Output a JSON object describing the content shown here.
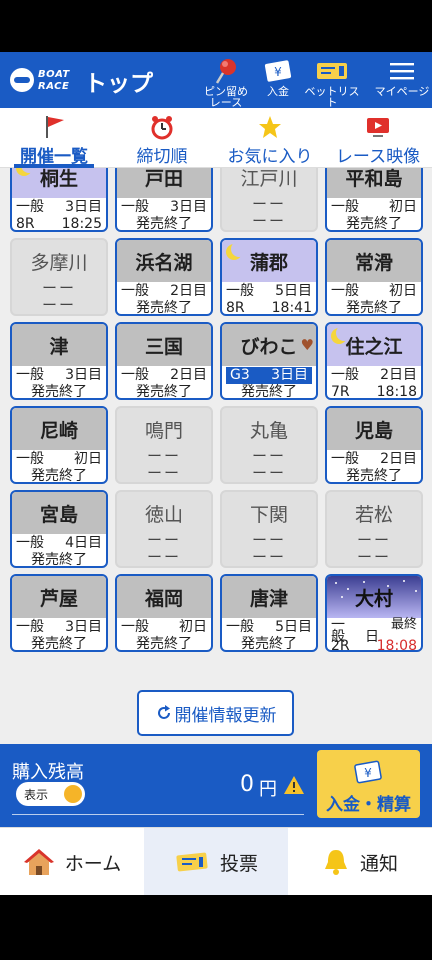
{
  "header": {
    "logo_line1": "BOAT",
    "logo_line2": "RACE",
    "title": "トップ",
    "pin_label_1": "ピン留め",
    "pin_label_2": "レース",
    "deposit_label": "入金",
    "betlist_label": "ベットリスト",
    "mypage_label": "マイページ"
  },
  "tabs": [
    {
      "label": "開催一覧",
      "icon": "flag-icon"
    },
    {
      "label": "締切順",
      "icon": "alarm-clock-icon"
    },
    {
      "label": "お気に入り",
      "icon": "star-icon"
    },
    {
      "label": "レース映像",
      "icon": "video-icon"
    }
  ],
  "venues": [
    {
      "name": "桐生",
      "status": "open",
      "night": true,
      "grade": "一般",
      "day": "3日目",
      "race": "8R",
      "time": "18:25"
    },
    {
      "name": "戸田",
      "status": "open",
      "grade": "一般",
      "day": "3日目",
      "note": "発売終了"
    },
    {
      "name": "江戸川",
      "status": "closed",
      "dash": "ーー"
    },
    {
      "name": "平和島",
      "status": "open",
      "grade": "一般",
      "day": "初日",
      "note": "発売終了"
    },
    {
      "name": "多摩川",
      "status": "closed",
      "dash": "ーー"
    },
    {
      "name": "浜名湖",
      "status": "open",
      "grade": "一般",
      "day": "2日目",
      "note": "発売終了"
    },
    {
      "name": "蒲郡",
      "status": "open",
      "night": true,
      "grade": "一般",
      "day": "5日目",
      "race": "8R",
      "time": "18:41"
    },
    {
      "name": "常滑",
      "status": "open",
      "grade": "一般",
      "day": "初日",
      "note": "発売終了"
    },
    {
      "name": "津",
      "status": "open",
      "grade": "一般",
      "day": "3日目",
      "note": "発売終了"
    },
    {
      "name": "三国",
      "status": "open",
      "grade": "一般",
      "day": "2日目",
      "note": "発売終了"
    },
    {
      "name": "びわこ",
      "status": "open",
      "favorite": true,
      "grade": "G3",
      "day": "3日目",
      "note": "発売終了"
    },
    {
      "name": "住之江",
      "status": "open",
      "night": true,
      "grade": "一般",
      "day": "2日目",
      "race": "7R",
      "time": "18:18"
    },
    {
      "name": "尼崎",
      "status": "open",
      "grade": "一般",
      "day": "初日",
      "note": "発売終了"
    },
    {
      "name": "鳴門",
      "status": "closed",
      "dash": "ーー"
    },
    {
      "name": "丸亀",
      "status": "closed",
      "dash": "ーー"
    },
    {
      "name": "児島",
      "status": "open",
      "grade": "一般",
      "day": "2日目",
      "note": "発売終了"
    },
    {
      "name": "宮島",
      "status": "open",
      "grade": "一般",
      "day": "4日目",
      "note": "発売終了"
    },
    {
      "name": "徳山",
      "status": "closed",
      "dash": "ーー"
    },
    {
      "name": "下関",
      "status": "closed",
      "dash": "ーー"
    },
    {
      "name": "若松",
      "status": "closed",
      "dash": "ーー"
    },
    {
      "name": "芦屋",
      "status": "open",
      "grade": "一般",
      "day": "3日目",
      "note": "発売終了"
    },
    {
      "name": "福岡",
      "status": "open",
      "grade": "一般",
      "day": "初日",
      "note": "発売終了"
    },
    {
      "name": "唐津",
      "status": "open",
      "grade": "一般",
      "day": "5日目",
      "note": "発売終了"
    },
    {
      "name": "大村",
      "status": "open",
      "nightsky": true,
      "grade_a": "一",
      "grade_b": "般",
      "day_a": "最終",
      "day_b": "日",
      "race": "2R",
      "time": "18:08"
    }
  ],
  "refresh_label": "開催情報更新",
  "balance": {
    "title": "購入残高",
    "toggle_label": "表示",
    "amount": "0",
    "currency": "円",
    "pay_label": "入金・精算"
  },
  "bottom_nav": [
    {
      "label": "ホーム",
      "icon": "home-icon"
    },
    {
      "label": "投票",
      "icon": "ticket-icon"
    },
    {
      "label": "通知",
      "icon": "bell-icon"
    }
  ]
}
